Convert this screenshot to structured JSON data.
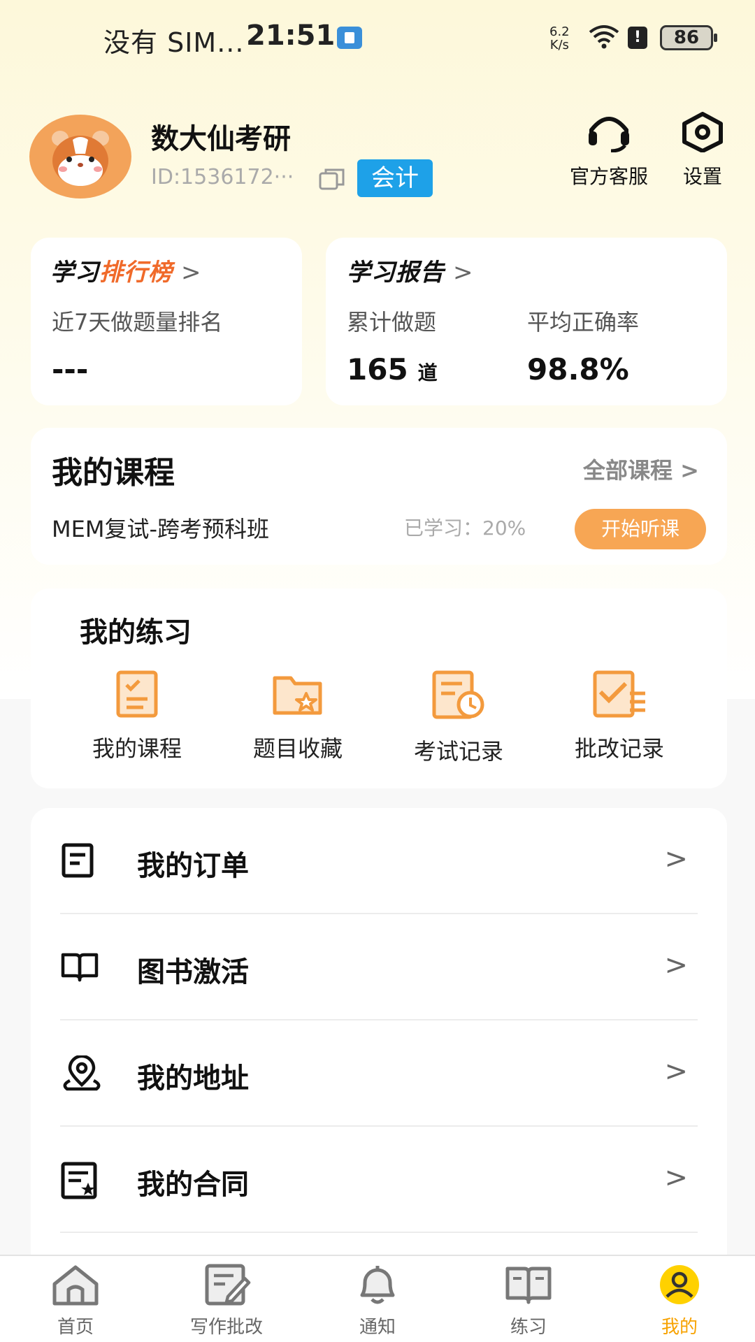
{
  "status_bar": {
    "carrier": "没有 SIM...",
    "time": "21:51",
    "net_speed_value": "6.2",
    "net_speed_unit": "K/s",
    "alert": "!",
    "battery": "86"
  },
  "profile": {
    "name": "数大仙考研",
    "id": "ID:1536172···",
    "tag": "会计"
  },
  "top_actions": {
    "customer_service": "官方客服",
    "settings": "设置"
  },
  "ranking": {
    "title_prefix": "学习",
    "title_accent": "排行榜",
    "chevron": ">",
    "subtitle": "近7天做题量排名",
    "value": "---"
  },
  "report": {
    "title": "学习报告",
    "chevron": ">",
    "total_label": "累计做题",
    "total_value": "165",
    "total_unit": "道",
    "accuracy_label": "平均正确率",
    "accuracy_value": "98.8%"
  },
  "courses": {
    "title": "我的课程",
    "all_label": "全部课程  >",
    "course_name": "MEM复试-跨考预科班",
    "progress_text": "已学习：20%",
    "start_button": "开始听课"
  },
  "practice": {
    "title": "我的练习",
    "items": [
      {
        "label": "我的课程",
        "icon": "clipboard-list-icon"
      },
      {
        "label": "题目收藏",
        "icon": "folder-star-icon"
      },
      {
        "label": "考试记录",
        "icon": "document-clock-icon"
      },
      {
        "label": "批改记录",
        "icon": "checked-list-icon"
      }
    ]
  },
  "menu": {
    "chevron": ">",
    "items": [
      {
        "label": "我的订单",
        "icon": "order-document-icon"
      },
      {
        "label": "图书激活",
        "icon": "open-book-icon"
      },
      {
        "label": "我的地址",
        "icon": "location-pin-icon"
      },
      {
        "label": "我的合同",
        "icon": "contract-icon"
      }
    ]
  },
  "bottom_nav": {
    "items": [
      {
        "label": "首页",
        "icon": "home-icon"
      },
      {
        "label": "写作批改",
        "icon": "edit-document-icon"
      },
      {
        "label": "通知",
        "icon": "bell-icon"
      },
      {
        "label": "练习",
        "icon": "book-icon"
      },
      {
        "label": "我的",
        "icon": "user-circle-icon"
      }
    ],
    "active_index": 4,
    "active_color": "#f7a200"
  },
  "colors": {
    "accent_orange": "#f7a654",
    "ranking_accent": "#f06a2a",
    "tag_blue": "#1ea1e8"
  }
}
